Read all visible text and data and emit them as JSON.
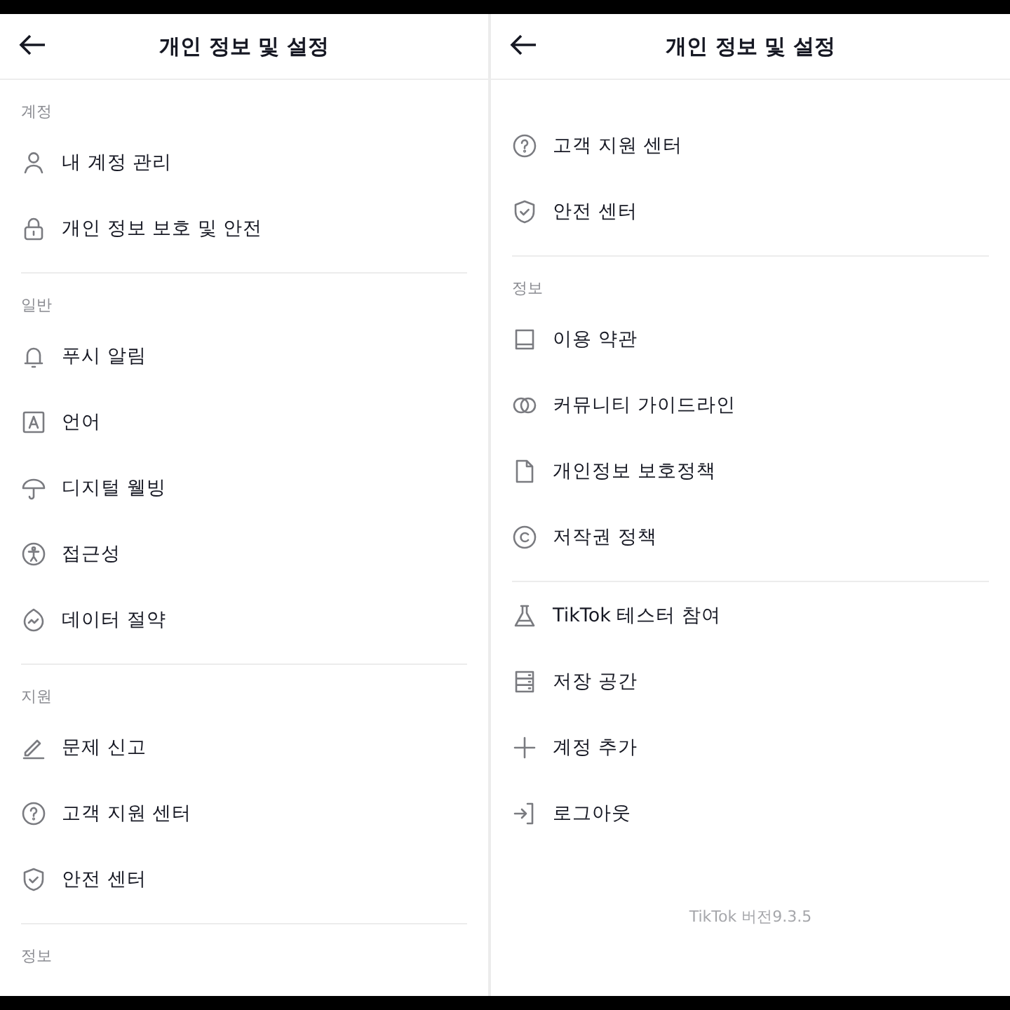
{
  "panels": [
    {
      "title": "개인 정보 및 설정",
      "entries": [
        {
          "kind": "section",
          "label": "계정"
        },
        {
          "kind": "item",
          "label": "내 계정 관리"
        },
        {
          "kind": "item",
          "label": "개인 정보 보호 및 안전"
        },
        {
          "kind": "divider"
        },
        {
          "kind": "section",
          "label": "일반"
        },
        {
          "kind": "item",
          "label": "푸시 알림"
        },
        {
          "kind": "item",
          "label": "언어"
        },
        {
          "kind": "item",
          "label": "디지털 웰빙"
        },
        {
          "kind": "item",
          "label": "접근성"
        },
        {
          "kind": "item",
          "label": "데이터 절약"
        },
        {
          "kind": "divider"
        },
        {
          "kind": "section",
          "label": "지원"
        },
        {
          "kind": "item",
          "label": "문제 신고"
        },
        {
          "kind": "item",
          "label": "고객 지원 센터"
        },
        {
          "kind": "item",
          "label": "안전 센터"
        },
        {
          "kind": "divider"
        },
        {
          "kind": "section",
          "label": "정보"
        }
      ]
    },
    {
      "title": "개인 정보 및 설정",
      "entries": [
        {
          "kind": "item",
          "label": "고객 지원 센터"
        },
        {
          "kind": "item",
          "label": "안전 센터"
        },
        {
          "kind": "divider"
        },
        {
          "kind": "section",
          "label": "정보"
        },
        {
          "kind": "item",
          "label": "이용 약관"
        },
        {
          "kind": "item",
          "label": "커뮤니티 가이드라인"
        },
        {
          "kind": "item",
          "label": "개인정보 보호정책"
        },
        {
          "kind": "item",
          "label": "저작권 정책"
        },
        {
          "kind": "divider"
        },
        {
          "kind": "item",
          "label": "TikTok 테스터 참여"
        },
        {
          "kind": "item",
          "label": "저장 공간"
        },
        {
          "kind": "item",
          "label": "계정 추가"
        },
        {
          "kind": "item",
          "label": "로그아웃"
        },
        {
          "kind": "version",
          "label": "TikTok 버전9.3.5"
        }
      ]
    }
  ]
}
